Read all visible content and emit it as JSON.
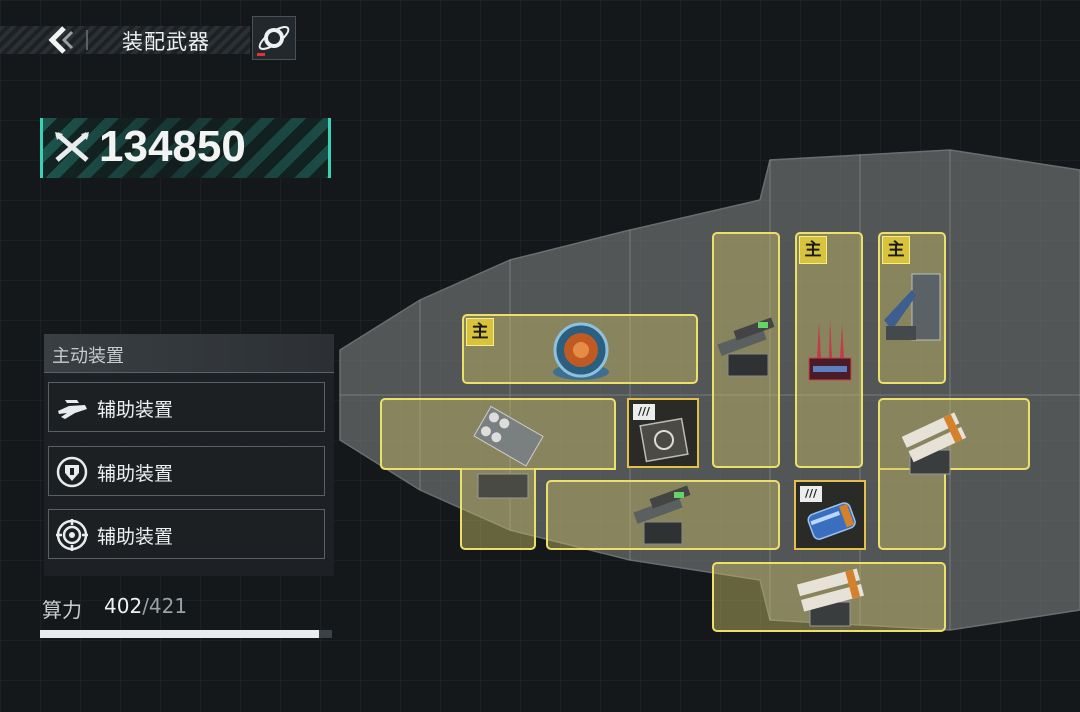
{
  "header": {
    "title": "装配武器"
  },
  "power": {
    "value": "134850"
  },
  "panel": {
    "header": "主动装置",
    "slots": [
      {
        "label": "辅助装置",
        "icon": "aircraft-icon"
      },
      {
        "label": "辅助装置",
        "icon": "shield-emblem-icon"
      },
      {
        "label": "辅助装置",
        "icon": "target-emblem-icon"
      }
    ]
  },
  "compute": {
    "label": "算力",
    "used": "402",
    "total": "/421",
    "fill": 0.955
  },
  "badges": {
    "main": "主",
    "aux_tag": "///"
  },
  "colors": {
    "slot": "#c9bd66",
    "slot_border": "#ede06a",
    "accent": "#39d4b8",
    "badge": "#d8c43c"
  }
}
